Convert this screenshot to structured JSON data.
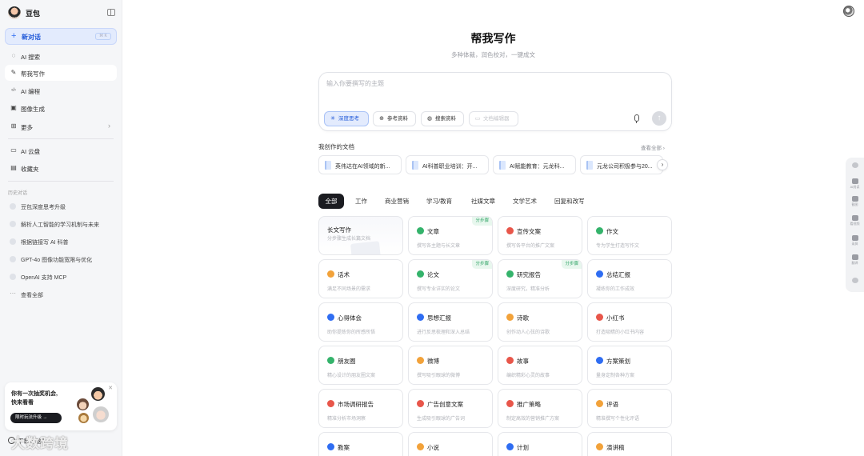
{
  "sidebar": {
    "brand": "豆包",
    "new_chat": {
      "label": "新对话",
      "shortcut": "⌘ K"
    },
    "nav": [
      {
        "label": "AI 搜索",
        "icon": "search-sparkle-icon",
        "glyph": "◌"
      },
      {
        "label": "帮我写作",
        "icon": "pen-icon",
        "glyph": "✎",
        "active": true
      },
      {
        "label": "AI 编程",
        "icon": "code-icon",
        "glyph": "‹/›"
      },
      {
        "label": "图像生成",
        "icon": "image-icon",
        "glyph": "▣"
      },
      {
        "label": "更多",
        "icon": "grid-icon",
        "glyph": "⊞"
      }
    ],
    "nav2": [
      {
        "label": "AI 云盘",
        "icon": "cloud-drive-icon",
        "glyph": "▭"
      },
      {
        "label": "收藏夹",
        "icon": "bookmark-icon",
        "glyph": "▤"
      }
    ],
    "history_label": "历史对话",
    "history": [
      "豆包深度思考升级",
      "解析人工智能的学习机制与未来",
      "根据链接写 AI 科普",
      "GPT-4o 图像功能宽限与优化",
      "OpenAI 支持 MCP",
      "查看全部"
    ],
    "promo": {
      "text_line1": "你有一次抽奖机会,",
      "text_line2": "快来看看",
      "button": "限时玩法升级 →"
    },
    "download": "下载电脑版",
    "watermark": "大数跨境"
  },
  "main": {
    "title": "帮我写作",
    "subtitle": "多种体裁，润色校对，一键成文",
    "composer": {
      "placeholder": "输入你要撰写的主题",
      "chips": [
        {
          "label": "深度思考",
          "icon": "deep-think-icon",
          "glyph": "✳",
          "selected": true
        },
        {
          "label": "参考资料",
          "icon": "plus-circle-icon",
          "glyph": "⊕"
        },
        {
          "label": "搜索资料",
          "icon": "globe-icon",
          "glyph": "◍"
        },
        {
          "label": "文档编辑器",
          "icon": "doc-editor-icon",
          "glyph": "▭",
          "disabled": true
        }
      ],
      "send_glyph": "↑"
    },
    "docs": {
      "title": "我创作的文档",
      "more": "查看全部 ›",
      "items": [
        "英伟达在AI领域的新...",
        "AI科普职业培训：开...",
        "AI赋能教育：元龙科...",
        "元龙公司积极参与20..."
      ]
    },
    "tabs": [
      "全部",
      "工作",
      "商业营销",
      "学习/教育",
      "社媒文章",
      "文学艺术",
      "回复和改写"
    ],
    "cards": [
      {
        "title": "长文写作",
        "desc": "分步骤生成长篇文档",
        "feature": true
      },
      {
        "title": "文章",
        "desc": "撰写各主题与长文章",
        "tag": "分步骤",
        "color": "#34b36b"
      },
      {
        "title": "宣传文案",
        "desc": "撰写各平台的推广文案",
        "color": "#e8564a"
      },
      {
        "title": "作文",
        "desc": "专为学生打造写作文",
        "color": "#34b36b"
      },
      {
        "title": "话术",
        "desc": "满足不同场景的需求",
        "color": "#f2a23a"
      },
      {
        "title": "论文",
        "desc": "撰写专业详实的论文",
        "tag": "分步骤",
        "color": "#34b36b"
      },
      {
        "title": "研究报告",
        "desc": "深度研究，精准分析",
        "tag": "分步骤",
        "color": "#34b36b"
      },
      {
        "title": "总结汇报",
        "desc": "凝练你的工作成效",
        "color": "#2f6df2"
      },
      {
        "title": "心得体会",
        "desc": "助你提炼你的所感所悟",
        "color": "#2f6df2"
      },
      {
        "title": "思想汇报",
        "desc": "进行反思梳理和深入总结",
        "color": "#2f6df2"
      },
      {
        "title": "诗歌",
        "desc": "创作动人心弦的诗歌",
        "color": "#f2a23a"
      },
      {
        "title": "小红书",
        "desc": "打造吸睛的小红书内容",
        "color": "#e8564a"
      },
      {
        "title": "朋友圈",
        "desc": "精心设计的朋友圈文案",
        "color": "#34b36b"
      },
      {
        "title": "微博",
        "desc": "撰写吸引眼球的微博",
        "color": "#f2a23a"
      },
      {
        "title": "故事",
        "desc": "编织精彩心灵的故事",
        "color": "#e8564a"
      },
      {
        "title": "方案策划",
        "desc": "量身定制各种方案",
        "color": "#2f6df2"
      },
      {
        "title": "市场调研报告",
        "desc": "精准分析市场洞察",
        "color": "#e8564a"
      },
      {
        "title": "广告创意文案",
        "desc": "生成吸引眼球的广告词",
        "color": "#e8564a"
      },
      {
        "title": "推广策略",
        "desc": "制定高效的营销推广方案",
        "color": "#e8564a"
      },
      {
        "title": "评语",
        "desc": "精准撰写个性化评语",
        "color": "#f2a23a"
      },
      {
        "title": "教案",
        "desc": "",
        "color": "#2f6df2"
      },
      {
        "title": "小说",
        "desc": "",
        "color": "#f2a23a"
      },
      {
        "title": "计划",
        "desc": "",
        "color": "#2f6df2"
      },
      {
        "title": "演讲稿",
        "desc": "",
        "color": "#f2a23a"
      }
    ]
  },
  "right_toolbar": {
    "items": [
      "AI阅读",
      "截图",
      "看视频",
      "录屏",
      "翻译"
    ]
  }
}
